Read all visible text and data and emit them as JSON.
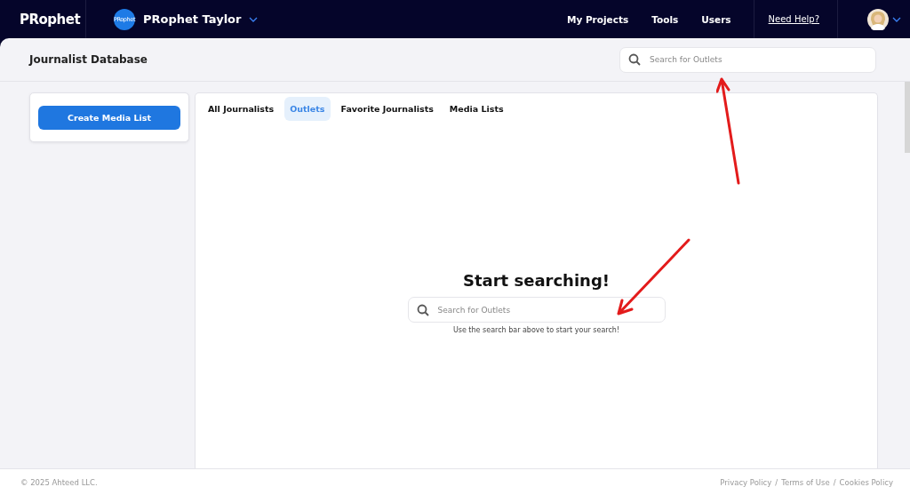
{
  "nav": {
    "logo": "PRophet",
    "workspace_badge": "PRophet",
    "workspace": "PRophet Taylor",
    "links": [
      {
        "label": "My Projects"
      },
      {
        "label": "Tools"
      },
      {
        "label": "Users"
      }
    ],
    "help": "Need Help?"
  },
  "header": {
    "title": "Journalist Database",
    "search": {
      "placeholder": "Search for Outlets"
    }
  },
  "sidebar": {
    "button": "Create Media List"
  },
  "tabs": [
    {
      "label": "All Journalists",
      "selected": false
    },
    {
      "label": "Outlets",
      "selected": true
    },
    {
      "label": "Favorite Journalists",
      "selected": false
    },
    {
      "label": "Media Lists",
      "selected": false
    }
  ],
  "empty_state": {
    "title": "Start searching!",
    "search": {
      "placeholder": "Search for Outlets"
    },
    "hint": "Use the search bar above to start your search!"
  },
  "footer": {
    "copyright": "© 2025 Ahteed LLC.",
    "links": [
      "Privacy Policy",
      "Terms of Use",
      "Cookies Policy"
    ],
    "separator": "/"
  }
}
